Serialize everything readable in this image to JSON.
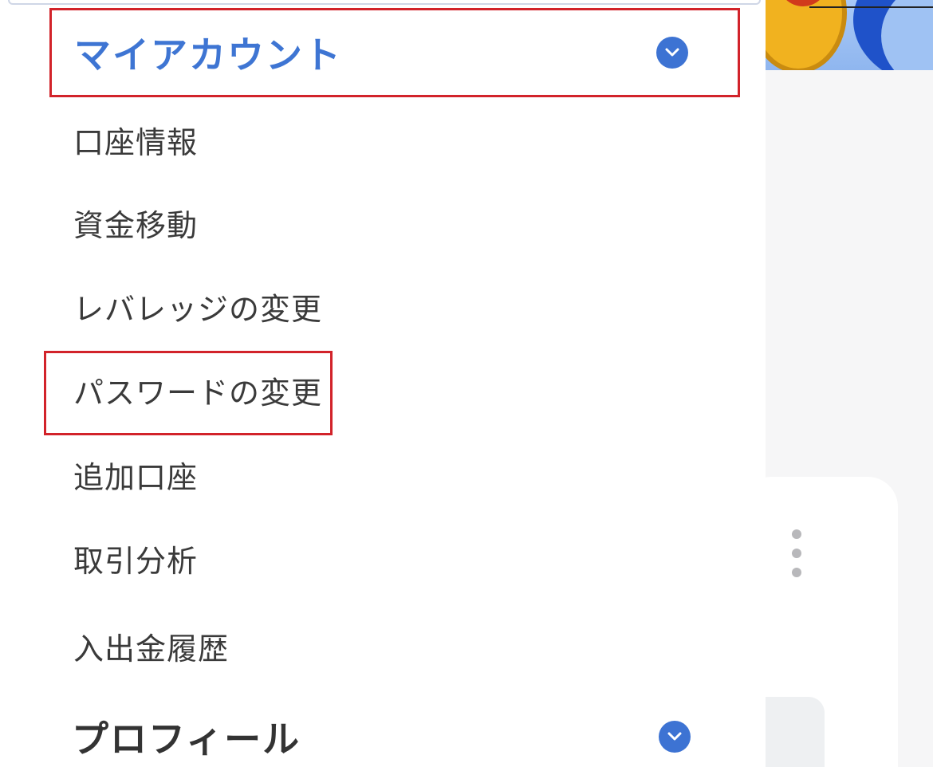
{
  "menu": {
    "my_account": {
      "title": "マイアカウント",
      "expand_icon": "chevron-down-icon",
      "items": [
        {
          "label": "口座情報"
        },
        {
          "label": "資金移動"
        },
        {
          "label": "レバレッジの変更"
        },
        {
          "label": "パスワードの変更"
        },
        {
          "label": "追加口座"
        },
        {
          "label": "取引分析"
        },
        {
          "label": "入出金履歴"
        }
      ]
    },
    "profile": {
      "title": "プロフィール",
      "expand_icon": "chevron-down-icon"
    }
  },
  "colors": {
    "accent_blue": "#3e75d3",
    "highlight_red": "#d2232a",
    "text_dark": "#333333"
  }
}
